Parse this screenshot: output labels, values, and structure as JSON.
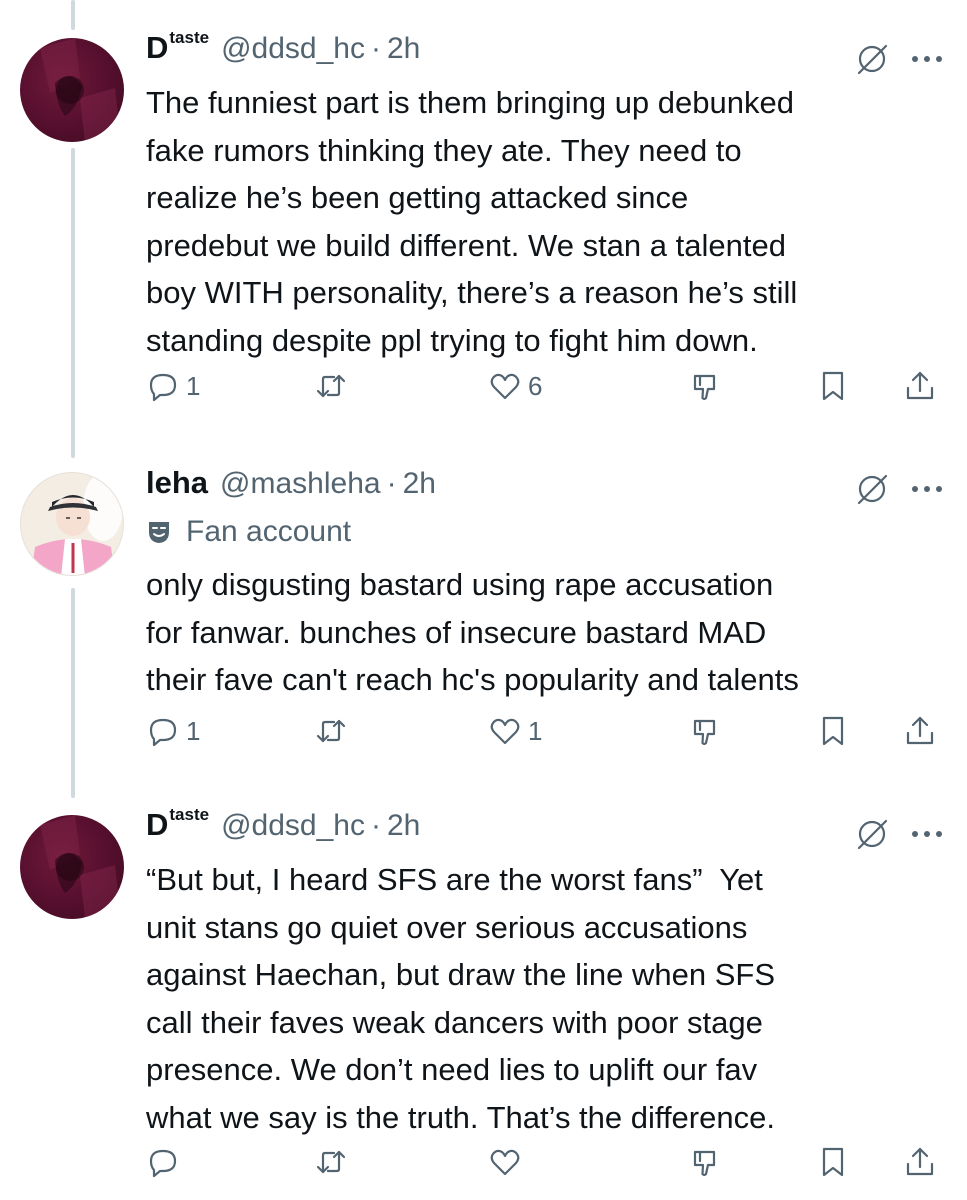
{
  "tweets": [
    {
      "name": "D",
      "name_sup": "taste",
      "handle": "@ddsd_hc",
      "separator": "·",
      "time": "2h",
      "fan_label": "",
      "lines": [
        "The funniest part is them bringing up debunked",
        "fake rumors thinking they ate. They need to",
        "realize he’s been getting attacked since",
        "predebut we build different. We stan a talented",
        "boy WITH personality, there’s a reason he’s still",
        "standing despite ppl trying to fight him down."
      ],
      "reply_count": "1",
      "retweet_count": "",
      "like_count": "6"
    },
    {
      "name": "leha",
      "name_sup": "",
      "handle": "@mashleha",
      "separator": "·",
      "time": "2h",
      "fan_label": "Fan account",
      "lines": [
        "only disgusting bastard using rape accusation",
        "for fanwar. bunches of insecure bastard MAD",
        "their fave can't reach hc's popularity and talents"
      ],
      "reply_count": "1",
      "retweet_count": "",
      "like_count": "1"
    },
    {
      "name": "D",
      "name_sup": "taste",
      "handle": "@ddsd_hc",
      "separator": "·",
      "time": "2h",
      "fan_label": "",
      "lines": [
        "“But but, I heard SFS are the worst fans”  Yet",
        "unit stans go quiet over serious accusations",
        "against Haechan, but draw the line when SFS",
        "call their faves weak dancers with poor stage",
        "presence. We don’t need lies to uplift our fav",
        "what we say is the truth. That’s the difference."
      ],
      "reply_count": "",
      "retweet_count": "",
      "like_count": ""
    }
  ],
  "icons": {
    "reply": "speech-bubble-icon",
    "retweet": "retweet-arrows-icon",
    "like": "heart-icon",
    "dislike": "thumbs-down-icon",
    "bookmark": "bookmark-icon",
    "share": "share-upload-icon",
    "grok": "grok-slash-icon",
    "more": "ellipsis-icon",
    "fan": "theater-mask-icon"
  },
  "colors": {
    "text": "#0f1419",
    "secondary": "#536471",
    "thread_line": "#cfd9de",
    "avatar_maroon": "#5a1030"
  }
}
